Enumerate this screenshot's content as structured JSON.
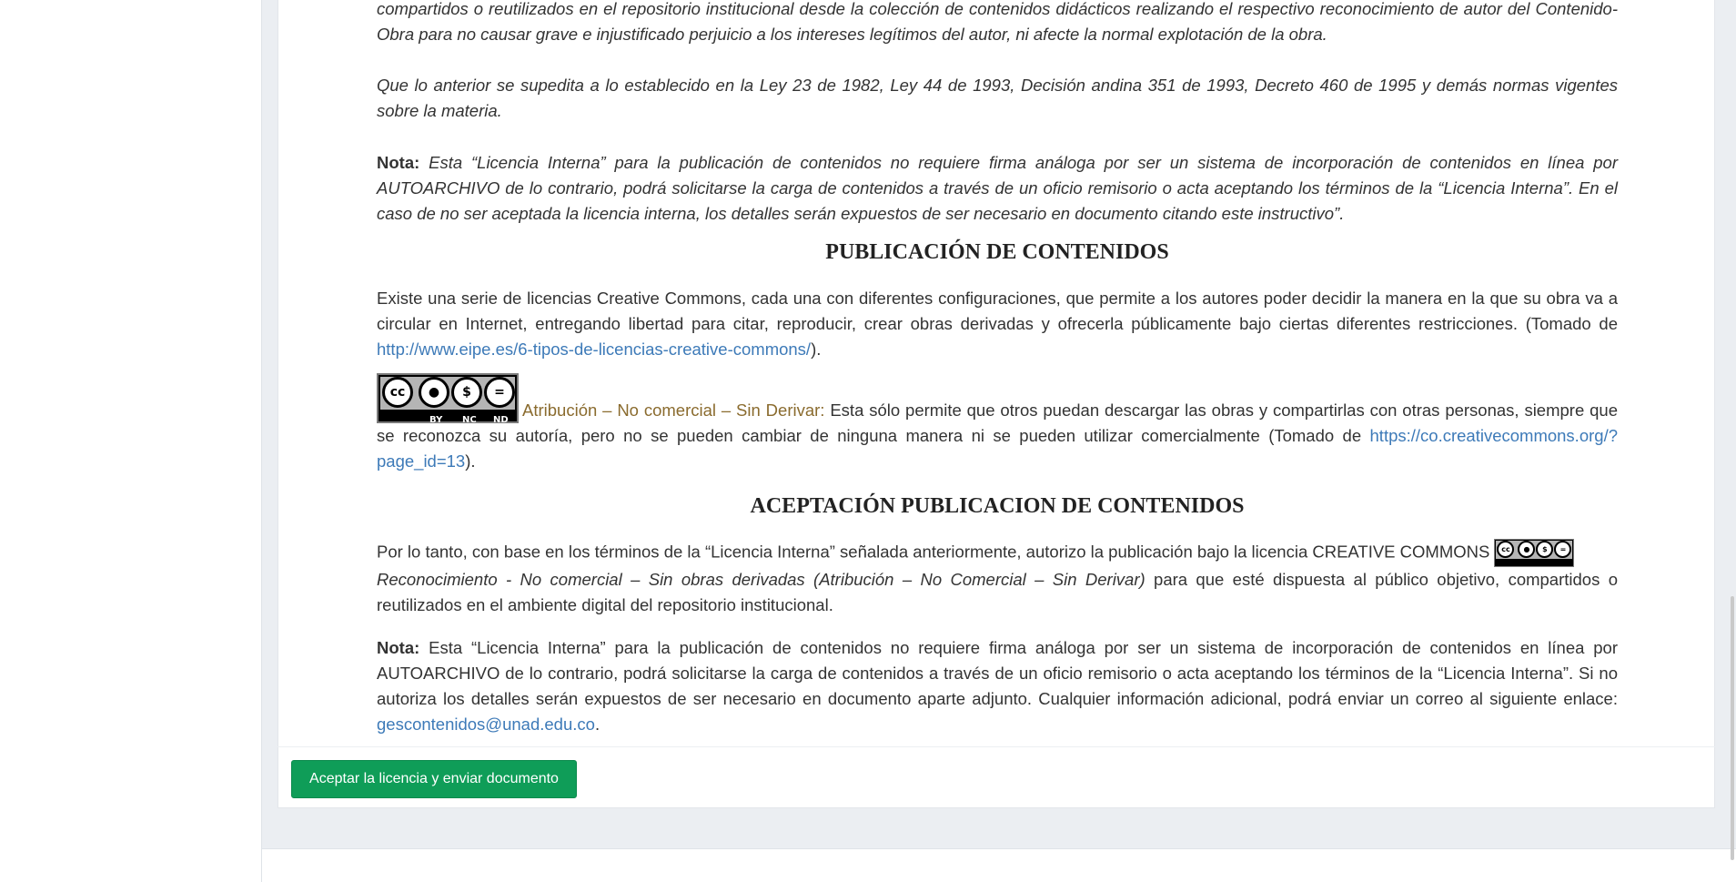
{
  "colors": {
    "accent_button": "#0f9d58",
    "link": "#3d7ab8",
    "license_title": "#8a6b2e",
    "page_bg": "#ebeef2"
  },
  "intro": {
    "para1": "compartidos o reutilizados en el repositorio institucional desde la colección de contenidos didácticos realizando el respectivo reconocimiento de autor del Contenido-Obra para no causar grave e injustificado perjuicio a los intereses legítimos del autor, ni afecte la normal explotación de la obra.",
    "para2": "Que lo anterior se supedita a lo establecido en la Ley 23 de 1982, Ley 44 de 1993, Decisión andina 351 de 1993, Decreto 460 de 1995 y demás normas vigentes sobre la materia.",
    "note_label": "Nota:",
    "note_text": " Esta “Licencia Interna” para la publicación de contenidos no requiere firma análoga por ser un sistema de incorporación de contenidos en línea por AUTOARCHIVO de lo contrario, podrá solicitarse la carga de contenidos a través de un oficio remisorio o acta aceptando los términos de la “Licencia Interna”. En el caso de no ser aceptada la licencia interna, los detalles serán expuestos de ser necesario en documento citando este instructivo”."
  },
  "publicacion": {
    "heading": "PUBLICACIÓN DE CONTENIDOS",
    "para_text": "Existe una serie de licencias Creative Commons, cada una con diferentes configuraciones, que permite a los autores poder decidir la manera en la que su obra va a circular en Internet, entregando libertad para citar, reproducir, crear obras derivadas y ofrecerla públicamente bajo ciertas diferentes restricciones. (Tomado de ",
    "para_link": "http://www.eipe.es/6-tipos-de-licencias-creative-commons/",
    "para_end": ").",
    "badge": {
      "cc": "cc",
      "labels": [
        "BY",
        "NC",
        "ND"
      ]
    },
    "license_title": "Atribución – No comercial – Sin Derivar:",
    "license_text": " Esta sólo permite que otros puedan descargar las obras y compartirlas con otras personas, siempre que se reconozca su autoría, pero no se pueden cambiar de ninguna manera ni se pueden utilizar comercialmente (Tomado de ",
    "license_link": "https://co.creativecommons.org/?page_id=13",
    "license_end": ")."
  },
  "aceptacion": {
    "heading": "ACEPTACIÓN PUBLICACION DE CONTENIDOS",
    "para_start": "Por lo tanto, con base en los términos de la “Licencia Interna” señalada anteriormente, autorizo la publicación bajo la licencia CREATIVE COMMONS ",
    "para_italic": "Reconocimiento - No comercial – Sin obras derivadas (Atribución – No Comercial – Sin Derivar)",
    "para_end": " para que esté dispuesta al público objetivo, compartidos o reutilizados en el ambiente digital del repositorio institucional.",
    "note_label": "Nota:",
    "note_text": " Esta “Licencia Interna” para la publicación de contenidos no requiere firma análoga por ser un sistema de incorporación de contenidos en línea por AUTOARCHIVO de lo contrario, podrá solicitarse la carga de contenidos a través de un oficio remisorio o acta aceptando los términos de la “Licencia Interna”. Si no autoriza los detalles serán expuestos de ser necesario en documento aparte adjunto. Cualquier información adicional, podrá enviar un correo al siguiente enlace: ",
    "email": "gescontenidos@unad.edu.co",
    "note_end": "."
  },
  "actions": {
    "accept_button": "Aceptar la licencia y enviar documento"
  }
}
